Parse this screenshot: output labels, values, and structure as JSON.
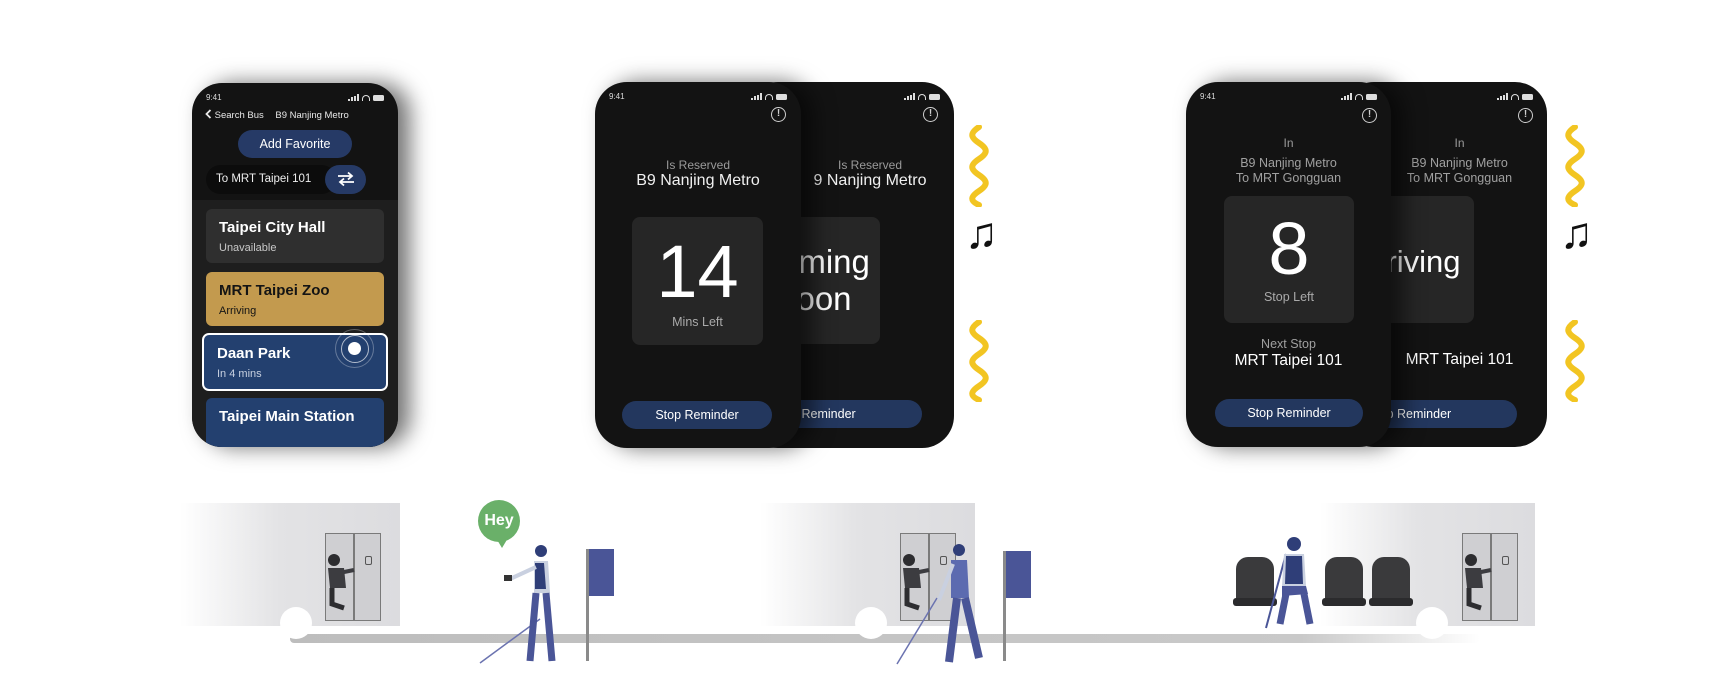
{
  "colors": {
    "phone_bg": "#131313",
    "accent_blue": "#263a66",
    "arriving_gold": "#c39a4e",
    "selected_blue": "#23406f",
    "vibration_yellow": "#f2c522",
    "bus_stop_flag": "#4a5597",
    "hey_bubble": "#6ab069"
  },
  "status_bar": {
    "time": "9:41"
  },
  "phone1": {
    "back_label": "Search Bus",
    "route_label": "B9 Nanjing Metro",
    "add_favorite": "Add Favorite",
    "direction": "To MRT Taipei 101",
    "stops": [
      {
        "name": "Taipei City Hall",
        "status": "Unavailable"
      },
      {
        "name": "MRT Taipei Zoo",
        "status": "Arriving"
      },
      {
        "name": "Daan Park",
        "status": "In 4 mins"
      },
      {
        "name": "Taipei Main Station",
        "status": ""
      }
    ]
  },
  "phone2_front": {
    "caption": "Is Reserved",
    "route": "B9 Nanjing Metro",
    "count": "14",
    "count_unit": "Mins Left",
    "button": "Stop Reminder"
  },
  "phone2_back": {
    "caption": "Is Reserved",
    "route": "9 Nanjing Metro",
    "count_line1": "Coming",
    "count_line2": "Soon",
    "button": "Stop Reminder"
  },
  "phone3_front": {
    "caption": "In",
    "route": "B9 Nanjing Metro",
    "direction": "To MRT Gongguan",
    "count": "8",
    "count_unit": "Stop Left",
    "next_label": "Next Stop",
    "next_stop": "MRT Taipei 101",
    "button": "Stop Reminder"
  },
  "phone3_back": {
    "caption": "In",
    "route": "B9 Nanjing Metro",
    "direction": "To MRT Gongguan",
    "count": "Arriving",
    "next_stop": "MRT Taipei 101",
    "button": "Stop Reminder"
  },
  "scene": {
    "speech": "Hey",
    "note_glyph": "♫"
  },
  "icons": [
    "chevron-left-icon",
    "swap-arrows-icon",
    "info-icon",
    "signal-icon",
    "wifi-icon",
    "battery-icon",
    "vibration-icon",
    "music-note-icon"
  ]
}
